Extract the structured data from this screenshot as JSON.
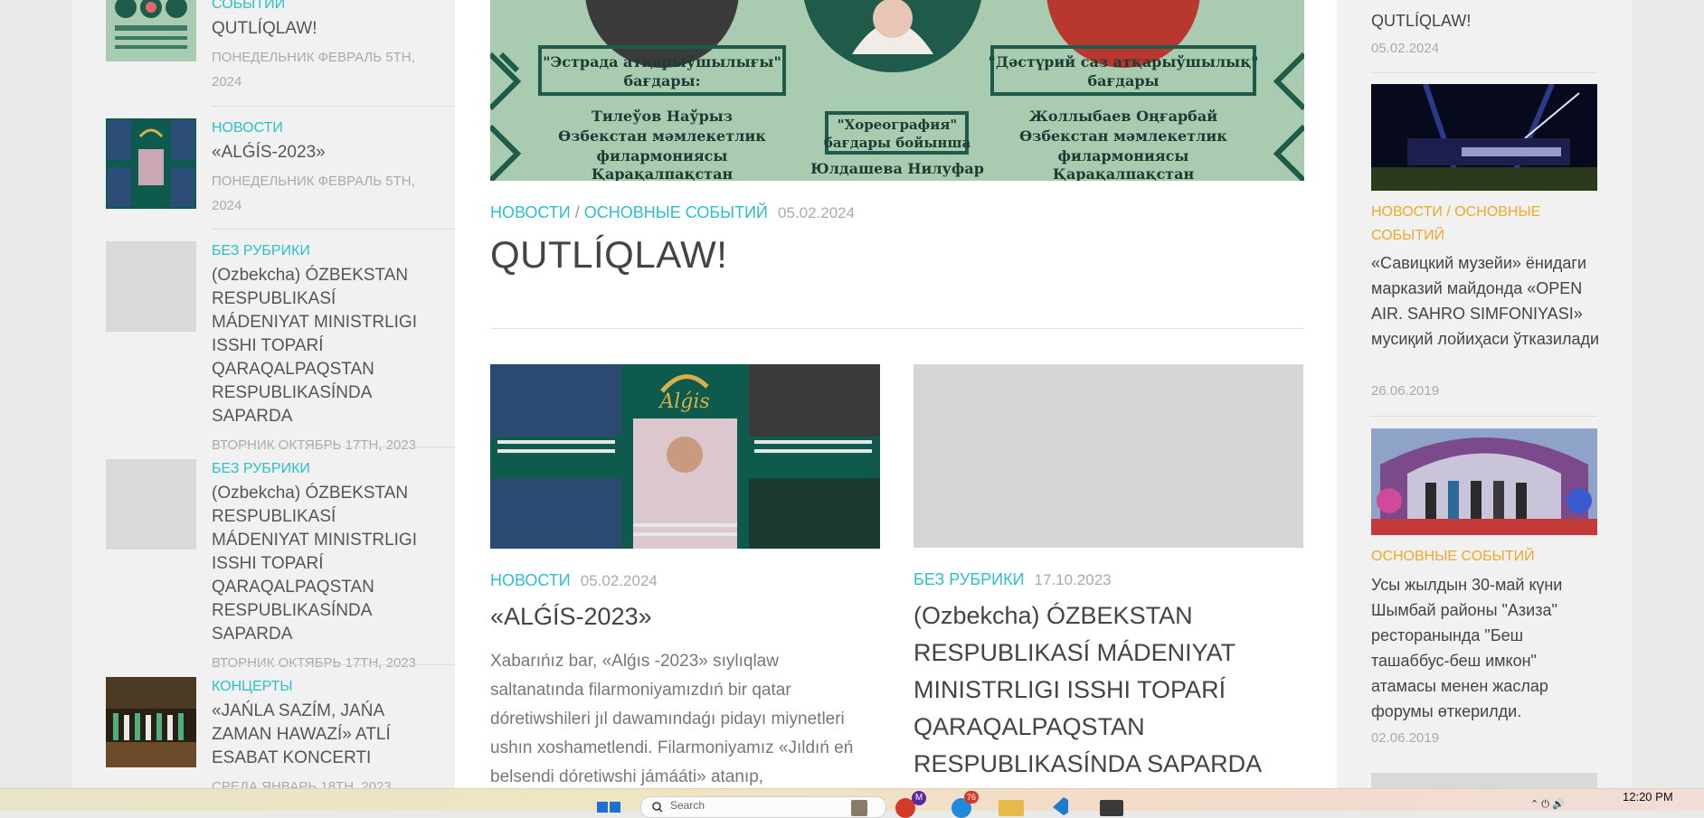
{
  "left_sidebar": {
    "items": [
      {
        "category": "СОБЫТИЙ",
        "title": "QUTLÍQLAW!",
        "date": "ПОНЕДЕЛЬНИК ФЕВРАЛЬ 5TH, 2024"
      },
      {
        "category": "НОВОСТИ",
        "title": "«ALǴÍS-2023»",
        "date": "ПОНЕДЕЛЬНИК ФЕВРАЛЬ 5TH, 2024"
      },
      {
        "category": "БЕЗ РУБРИКИ",
        "title": "(Ozbekcha) ÓZBEKSTAN RESPUBLIKASÍ MÁDENIYAT MINISTRLIGI ISSHI TOPARÍ QARAQALPAQSTAN RESPUBLIKASÍNDA SAPARDA",
        "date": "ВТОРНИК ОКТЯБРЬ 17TH, 2023"
      },
      {
        "category": "БЕЗ РУБРИКИ",
        "title": "(Ozbekcha) ÓZBEKSTAN RESPUBLIKASÍ MÁDENIYAT MINISTRLIGI ISSHI TOPARÍ QARAQALPAQSTAN RESPUBLIKASÍNDA SAPARDA",
        "date": "ВТОРНИК ОКТЯБРЬ 17TH, 2023"
      },
      {
        "category": "КОНЦЕРТЫ",
        "title": "«JAŃLA SAZÍM, JAŃA ZAMAN HAWAZÍ» ATLÍ ESABAT KONCERTI",
        "date": "СРЕДА ЯНВАРЬ 18TH, 2023"
      }
    ]
  },
  "main": {
    "banner": {
      "text_left_heading": "\"Эстрада атқарыўшылығы\" бағдары:",
      "text_left_body": "Тилеўов Наўрыз Өзбекстан мәмлекетлик филармониясы Қарақалпақстан",
      "text_center_heading": "\"Хореография\" бағдары бойынша",
      "text_center_body": "Юлдашева Нилуфар",
      "text_right_heading": "\"Дәстүрий саз атқарыўшылық\" бағдары",
      "text_right_body": "Жоллыбаев Оңғарбай Өзбекстан мәмлекетлик филармониясы Қарақалпақстан"
    },
    "featured": {
      "category1": "НОВОСТИ",
      "separator": "/",
      "category2": "ОСНОВНЫЕ СОБЫТИЙ",
      "date": "05.02.2024",
      "title": "QUTLÍQLAW!"
    },
    "card_left": {
      "category": "НОВОСТИ",
      "date": "05.02.2024",
      "title": "«ALǴÍS-2023»",
      "excerpt": "Xabarıńız bar, «Alǵıs -2023» sıylıqlaw saltanatında filarmoniyamızdıń bir qatar dóretiwshileri jıl dawamındaǵı pidayı miynetleri ushın xoshametlendi. Filarmoniyamız «Jıldıń eń belsendi dóretiwshi jámááti» atanıp,",
      "image_brand": "Alǵis"
    },
    "card_right": {
      "category": "БЕЗ РУБРИКИ",
      "date": "17.10.2023",
      "title": "(Ozbekcha) ÓZBEKSTAN RESPUBLIKASÍ MÁDENIYAT MINISTRLIGI ISSHI TOPARÍ QARAQALPAQSTAN RESPUBLIKASÍNDA SAPARDA"
    }
  },
  "right_sidebar": {
    "items": [
      {
        "title": "QUTLÍQLAW!",
        "date": "05.02.2024"
      },
      {
        "category": "НОВОСТИ / ОСНОВНЫЕ СОБЫТИЙ",
        "title": "«Савицкий музейи» ёнидаги марказий майдонда «OPEN AIR. SAHRO SIMFONIYASI» мусиқий лойиҳаси ўтказилади",
        "date": "26.06.2019"
      },
      {
        "category": "ОСНОВНЫЕ СОБЫТИЙ",
        "title": "Усы жылдын 30-май күни Шымбай районы \"Азиза\" ресторанында \"Беш ташаббус-беш имкон\" атамасы менен жаслар форумы өткерилди.",
        "date": "02.06.2019"
      }
    ]
  },
  "taskbar": {
    "clock": "12:20 PM",
    "badge_mail": "M",
    "badge_count": "76",
    "search_placeholder": "Search"
  },
  "colors": {
    "accent_teal": "#2bc0c9",
    "accent_orange": "#f0a72a",
    "banner_green": "#a9cbb0",
    "banner_dark": "#1f5b4b"
  }
}
